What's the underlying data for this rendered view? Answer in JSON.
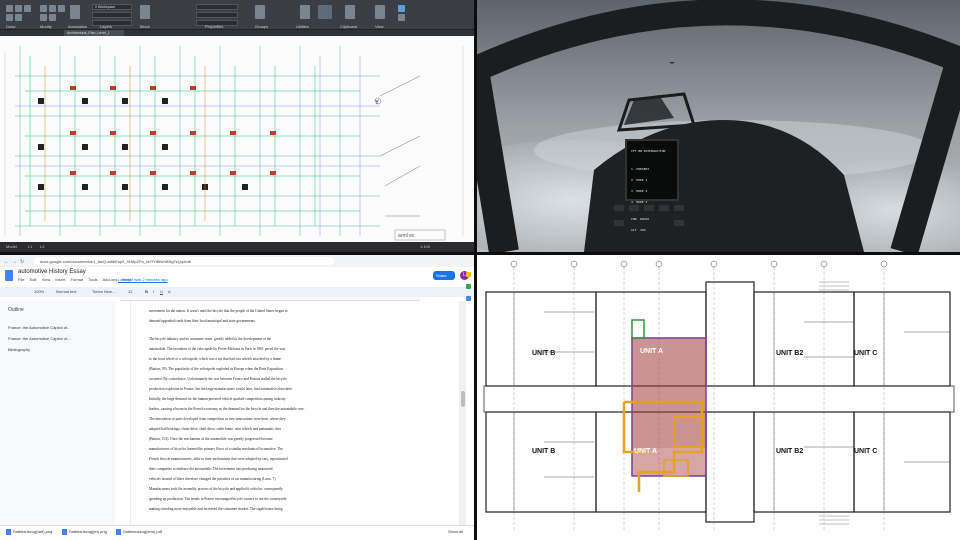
{
  "cad": {
    "panel_labels": [
      "Draw",
      "Modify",
      "Annotation",
      "Layers",
      "Block",
      "Properties",
      "Groups",
      "Utilities",
      "Clipboard",
      "View"
    ],
    "layer_combo": "0 Workspace",
    "tab_active": "Architectural_Plan_Level_1",
    "status": [
      "Model",
      "L1",
      "L2",
      "1:100"
    ],
    "logo": "arml ec"
  },
  "cockpit": {
    "mfd_lines": [
      "IFF BN INTEROGATION",
      "",
      "1  PRESENT",
      "2  MODE 1",
      "3  MODE 2",
      "4  MODE 3",
      "",
      "CHN  RADIO  ",
      "ALT  450"
    ]
  },
  "docs": {
    "url": "docs.google.com/document/d/1_8wQ-at8bEsp2_XH8pZPo_MYfYlBNmlE8gTeQq/edit",
    "title": "automotive History Essay",
    "menu": [
      "File",
      "Edit",
      "View",
      "Insert",
      "Format",
      "Tools",
      "Add-ons",
      "Help"
    ],
    "last_edit": "Last edit was 2 minutes ago",
    "share": "Share",
    "avatar": "L",
    "toolbar": [
      "100%",
      "Normal text",
      "Times New...",
      "12",
      "B",
      "I",
      "U",
      "A"
    ],
    "outline_head": "Outline",
    "outline_items": [
      "France: the Automotive Capitol of...",
      "France: the Automotive Capitol of...",
      "Bibliography"
    ],
    "page_lines": [
      "investment for the nation. It wasn't until the bicycle that the people of the United States began to",
      "demand upgraded roads from their local municipal and state governments.",
      "",
      "      The bicycle industry and its consumer craze, greatly added to the development of the",
      "automobile. The invention of the velocipede by Pierre Michaux in Paris in 1861 paved the way",
      "to the front wheel of a velocipede, which was a toy that had two wheels attached by a frame",
      "(Barton, 59). The popularity of the velocipede exploded in Europe when the Paris Exposition",
      "occurred. By coincidence, Unfortunately the war between France and Prussia stalled the bicycle",
      "production explosion in France, but the large manufacturers would later, find automotive elsewhere.",
      "Initially, the large demand for the human powered vehicle sparked competition among industry",
      "leaders, causing a boom in the French economy, as the demand for the bicycle and then the automobile rose.",
      "The innovation of parts developed from competition as new innovations were born, where they",
      "adopted ball bearings, chain drive, shaft drive, cable brake, wire wheels and pneumatic tires",
      "(Barton, 101). Once the mechanism of the automobile was greatly progressed because",
      "manufacturers of bicycles learned the primary flows of a similar mechanical locomotive. The",
      "French bicycle manufacturers, alike to their mechanisms that were adopted by cars, repositioned",
      "their companies to embrace the automobile. The investment into producing motorized",
      "vehicles instead of bikes therefore changed the priorities of car manufacturing (Laux, 7).",
      "Manufacturers took the assembly process of the bicycle and applied it vehicles, consequently",
      "speeding up production. The trends in France encouraged bicycle owners to use the countryside",
      "making traveling more enjoyable and increased the consumer market. The significance being"
    ],
    "downloads": [
      "Sattelauszug(tarf).png",
      "Sattelauszug(jet).png",
      "Sattelauszug(lem).pdf"
    ],
    "show_all": "Show all"
  },
  "plan": {
    "unit_labels": [
      "UNIT B",
      "UNIT A",
      "UNIT B2",
      "UNIT C",
      "UNIT B",
      "UNIT A",
      "UNIT B2",
      "UNIT C"
    ]
  }
}
